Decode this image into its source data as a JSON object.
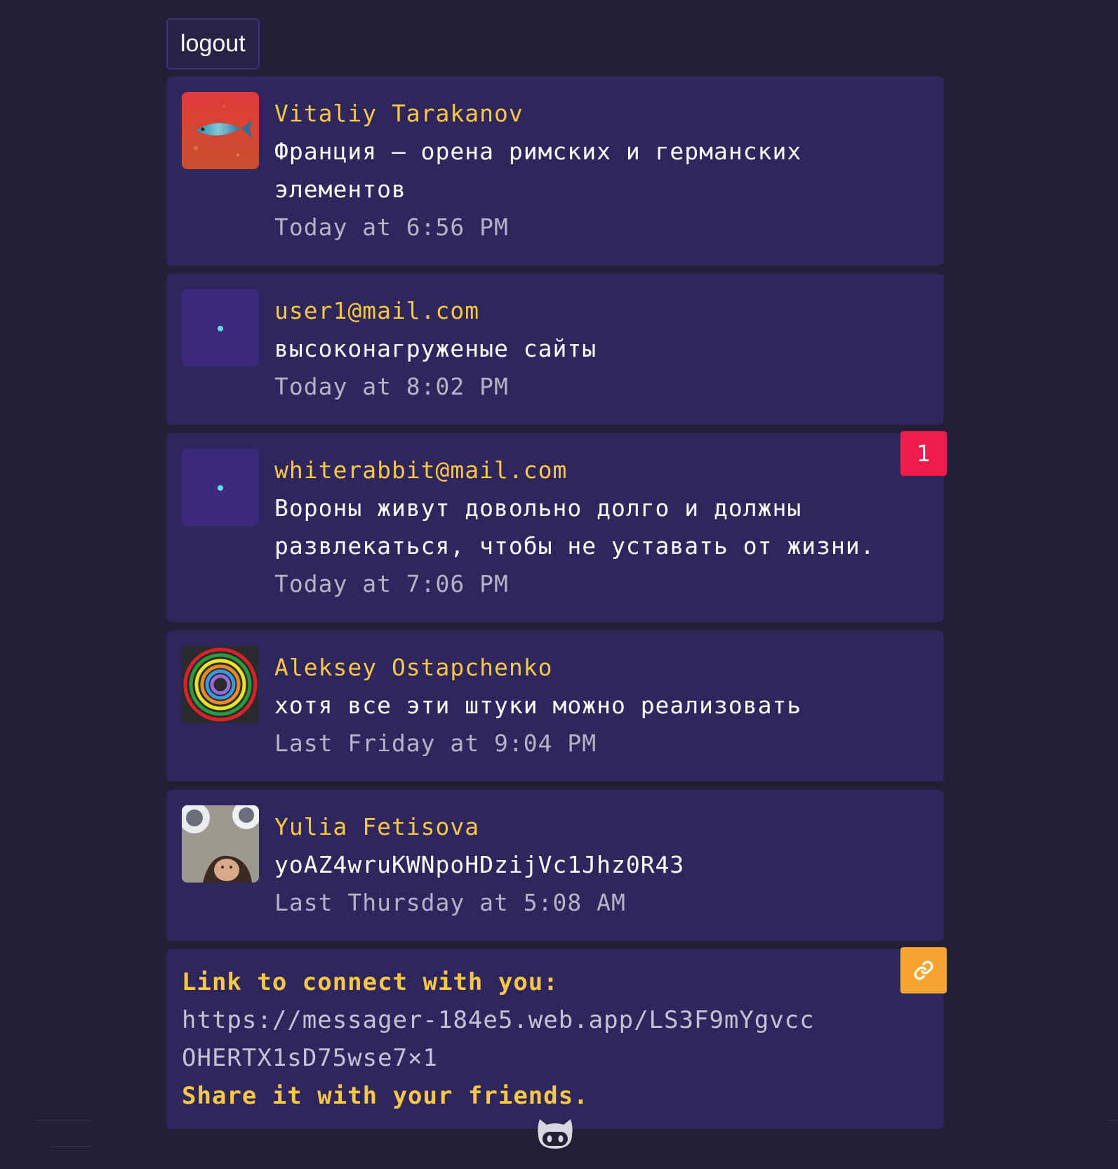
{
  "header": {
    "logout_label": "logout"
  },
  "chats": [
    {
      "name": "Vitaliy Tarakanov",
      "message": "Франция – орена римских и германских элементов",
      "time": "Today at 6:56 PM",
      "avatar": "fish-painting-avatar"
    },
    {
      "name": "user1@mail.com",
      "message": "высоконагруженые сайты",
      "time": "Today at 8:02 PM",
      "avatar": "default-dot-avatar"
    },
    {
      "name": "whiterabbit@mail.com",
      "message": "Вороны живут довольно долго и должны развлекаться, чтобы не уставать от жизни.",
      "time": "Today at 7:06 PM",
      "avatar": "default-dot-avatar",
      "unread": "1"
    },
    {
      "name": "Aleksey Ostapchenko",
      "message": "хотя все эти штуки можно реализовать",
      "time": "Last Friday at 9:04 PM",
      "avatar": "rainbow-rings-avatar"
    },
    {
      "name": "Yulia Fetisova",
      "message": "yoAZ4wruKWNpoHDzijVc1Jhz0R43",
      "time": "Last Thursday at 5:08 AM",
      "avatar": "photo-avatar"
    }
  ],
  "invite": {
    "title": "Link to connect with you:",
    "url": "https://messager-184e5.web.app/LS3F9mYgvccOHERTX1sD75wse7×1",
    "share": "Share it with your friends.",
    "copy_icon": "link-icon"
  },
  "footer": {
    "icon": "github-icon"
  },
  "colors": {
    "background": "#221f37",
    "card": "#30265e",
    "name": "#f7c845",
    "badge": "#ee1c4a",
    "copy_button": "#f5a430"
  }
}
